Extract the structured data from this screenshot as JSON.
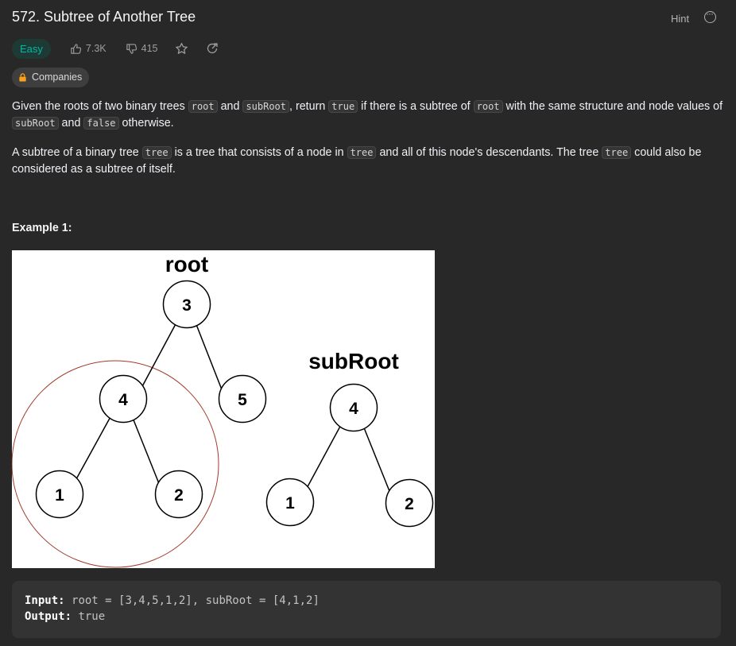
{
  "problem": {
    "title": "572. Subtree of Another Tree",
    "hint_label": "Hint",
    "difficulty": "Easy",
    "likes": "7.3K",
    "dislikes": "415",
    "companies_label": "Companies"
  },
  "description": {
    "p1": {
      "t1": "Given the roots of two binary trees ",
      "c1": "root",
      "t2": " and ",
      "c2": "subRoot",
      "t3": ", return ",
      "c3": "true",
      "t4": " if there is a subtree of ",
      "c4": "root",
      "t5": " with the same structure and node values of ",
      "c5": "subRoot",
      "t6": " and ",
      "c6": "false",
      "t7": " otherwise."
    },
    "p2": {
      "t1": "A subtree of a binary tree ",
      "c1": "tree",
      "t2": " is a tree that consists of a node in ",
      "c2": "tree",
      "t3": " and all of this node's descendants. The tree ",
      "c3": "tree",
      "t4": " could also be considered as a subtree of itself."
    }
  },
  "example": {
    "title": "Example 1:",
    "figure": {
      "root_label": "root",
      "subroot_label": "subRoot",
      "root_nodes": [
        "3",
        "4",
        "5",
        "1",
        "2"
      ],
      "subroot_nodes": [
        "4",
        "1",
        "2"
      ]
    },
    "input_label": "Input:",
    "input_value": "root = [3,4,5,1,2], subRoot = [4,1,2]",
    "output_label": "Output:",
    "output_value": "true"
  },
  "colors": {
    "easy": "#00b8a3",
    "highlight_circle": "#a33a2a"
  }
}
